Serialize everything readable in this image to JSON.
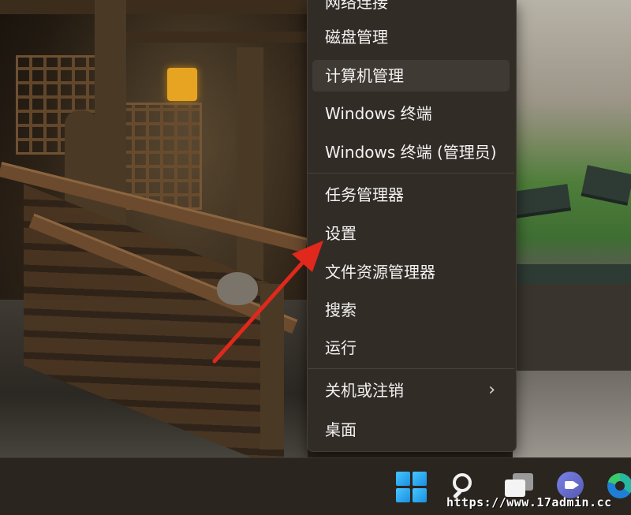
{
  "context_menu": {
    "items": [
      {
        "label": "网络连接"
      },
      {
        "label": "磁盘管理"
      },
      {
        "label": "计算机管理"
      },
      {
        "label": "Windows 终端"
      },
      {
        "label": "Windows 终端 (管理员)"
      },
      {
        "label": "任务管理器"
      },
      {
        "label": "设置"
      },
      {
        "label": "文件资源管理器"
      },
      {
        "label": "搜索"
      },
      {
        "label": "运行"
      },
      {
        "label": "关机或注销",
        "submenu_indicator": "›"
      },
      {
        "label": "桌面"
      }
    ],
    "hovered_item": "计算机管理"
  },
  "annotation": {
    "arrow_color": "#e0281c",
    "points_to": "设置"
  },
  "taskbar": {
    "icons": [
      "windows-start-icon",
      "search-icon",
      "task-view-icon",
      "teams-chat-icon",
      "edge-browser-icon"
    ]
  },
  "watermark": {
    "text": "https://www.17admin.cc"
  }
}
